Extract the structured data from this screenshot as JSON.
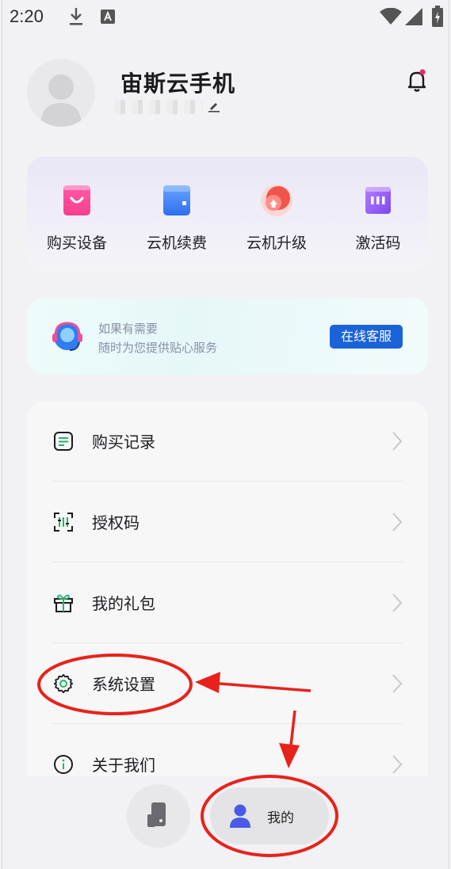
{
  "status_bar": {
    "time": "2:20"
  },
  "profile": {
    "app_name": "宙斯云手机"
  },
  "quick_actions": [
    {
      "label": "购买设备",
      "icon": "shopping-bag-icon"
    },
    {
      "label": "云机续费",
      "icon": "wallet-icon"
    },
    {
      "label": "云机升级",
      "icon": "upgrade-icon"
    },
    {
      "label": "激活码",
      "icon": "activation-code-icon"
    }
  ],
  "customer_service": {
    "line1": "如果有需要",
    "line2": "随时为您提供贴心服务",
    "button": "在线客服"
  },
  "menu": [
    {
      "label": "购买记录",
      "icon": "receipt-icon"
    },
    {
      "label": "授权码",
      "icon": "scan-code-icon"
    },
    {
      "label": "我的礼包",
      "icon": "gift-icon"
    },
    {
      "label": "系统设置",
      "icon": "gear-icon"
    },
    {
      "label": "关于我们",
      "icon": "info-icon"
    }
  ],
  "bottom_nav": {
    "mine_label": "我的"
  },
  "colors": {
    "accent": "#1a62d8",
    "annotation": "#e8221b",
    "nav_active_icon": "#4a5ae8"
  }
}
